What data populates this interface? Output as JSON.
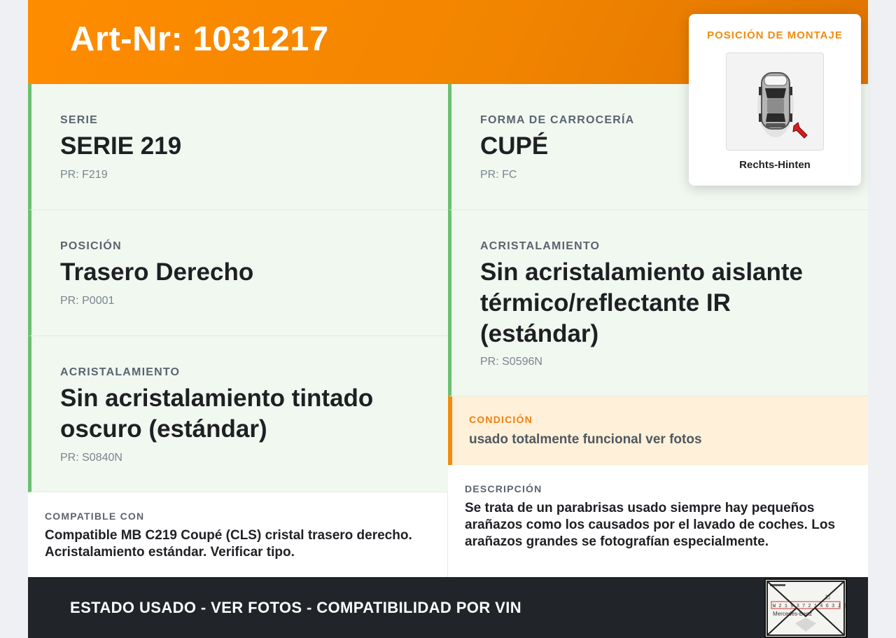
{
  "header": {
    "title": "Art-Nr: 1031217"
  },
  "cells": {
    "serie": {
      "label": "SERIE",
      "value": "SERIE 219",
      "pr": "PR: F219"
    },
    "carroceria": {
      "label": "FORMA DE CARROCERÍA",
      "value": "CUPÉ",
      "pr": "PR: FC"
    },
    "posicion": {
      "label": "POSICIÓN",
      "value": "Trasero Derecho",
      "pr": "PR: P0001"
    },
    "acrist_right": {
      "label": "ACRISTALAMIENTO",
      "value": "Sin acristalamiento aislante térmico/reflectante IR (estándar)",
      "pr": "PR: S0596N"
    },
    "acrist_left": {
      "label": "ACRISTALAMIENTO",
      "value": "Sin acristalamiento tintado oscuro (estándar)",
      "pr": "PR: S0840N"
    }
  },
  "condition": {
    "label": "CONDICIÓN",
    "text": "usado totalmente funcional ver fotos"
  },
  "compatible": {
    "label": "COMPATIBLE CON",
    "text": "Compatible MB C219 Coupé (CLS) cristal trasero derecho. Acristalamiento estándar. Verificar tipo."
  },
  "description": {
    "label": "DESCRIPCIÓN",
    "text": "Se trata de un parabrisas usado siempre hay pequeños arañazos como los causados por el lavado de coches. Los arañazos grandes se fotografían especialmente."
  },
  "footer": {
    "text": "ESTADO USADO - VER FOTOS - COMPATIBILIDAD POR VIN"
  },
  "mount_popup": {
    "title": "POSICIÓN DE MONTAJE",
    "caption": "Rechts-Hinten"
  },
  "thumbnail": {
    "line1": "W 2 1 9 3 7 2 1 4 6 3 J 0 1 9 1 9",
    "line2": "Mercedes-Benz"
  },
  "colors": {
    "accent": "#f28c0f",
    "green_border": "#6cc070",
    "green_bg": "#f0f8f0",
    "footer_bg": "#212529"
  }
}
